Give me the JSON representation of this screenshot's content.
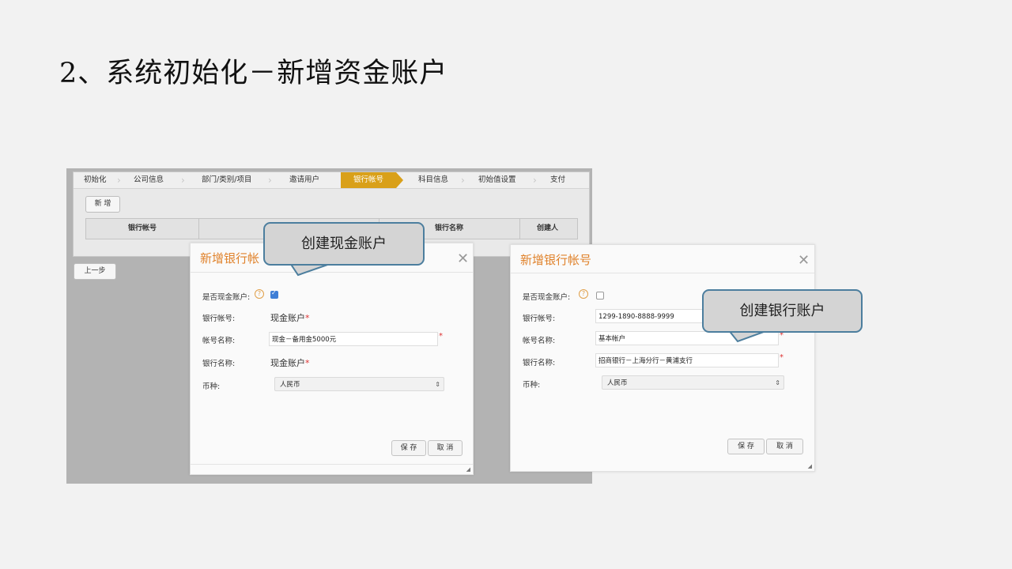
{
  "slide": {
    "title": "2、系统初始化－新增资金账户"
  },
  "app": {
    "steps": [
      {
        "label": "初始化",
        "active": false
      },
      {
        "label": "公司信息",
        "active": false
      },
      {
        "label": "部门/类别/项目",
        "active": false
      },
      {
        "label": "邀请用户",
        "active": false
      },
      {
        "label": "银行帐号",
        "active": true
      },
      {
        "label": "科目信息",
        "active": false
      },
      {
        "label": "初始值设置",
        "active": false
      },
      {
        "label": "支付",
        "active": false
      }
    ],
    "add_button": "新 增",
    "columns": [
      "银行帐号",
      "银行名称",
      "创建人"
    ],
    "prev_button": "上一步"
  },
  "dialog_cash": {
    "title": "新增银行帐",
    "close": "✕",
    "is_cash_label": "是否现金账户:",
    "help": "?",
    "is_cash_checked": true,
    "account_no_label": "银行帐号:",
    "account_no_value": "现金账户",
    "account_name_label": "帐号名称:",
    "account_name_value": "现金－备用金5000元",
    "bank_name_label": "银行名称:",
    "bank_name_value": "现金账户",
    "currency_label": "币种:",
    "currency_value": "人民币",
    "save": "保 存",
    "cancel": "取 消",
    "required": "*"
  },
  "dialog_bank": {
    "title": "新增银行帐号",
    "close": "✕",
    "is_cash_label": "是否现金账户:",
    "help": "?",
    "is_cash_checked": false,
    "account_no_label": "银行帐号:",
    "account_no_value": "1299-1890-8888-9999",
    "account_name_label": "帐号名称:",
    "account_name_value": "基本帐户",
    "bank_name_label": "银行名称:",
    "bank_name_value": "招商银行－上海分行－黄浦支行",
    "currency_label": "币种:",
    "currency_value": "人民币",
    "save": "保 存",
    "cancel": "取 消",
    "required": "*"
  },
  "callouts": {
    "cash": "创建现金账户",
    "bank": "创建银行账户"
  },
  "colors": {
    "active_step": "#d9a019",
    "dialog_title": "#e0822b",
    "callout_border": "#4c7e9e",
    "callout_fill": "#d4d4d4"
  }
}
